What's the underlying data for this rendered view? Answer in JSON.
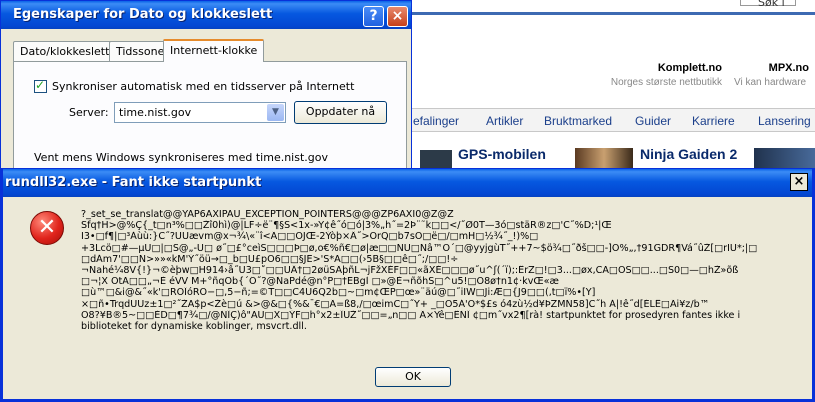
{
  "web": {
    "search_button": "Søk i",
    "partners": [
      {
        "name": "Komplett.no",
        "desc": "Norges største nettbutikk"
      },
      {
        "name": "MPX.no",
        "desc": "Vi kan hardware"
      }
    ],
    "nav": [
      "efalinger",
      "Artikler",
      "Bruktmarked",
      "Guider",
      "Karriere",
      "Lansering"
    ],
    "news": [
      "GPS-mobilen",
      "Ninja Gaiden 2"
    ]
  },
  "props_dialog": {
    "title": "Egenskaper for Dato og klokkeslett",
    "help_button": "?",
    "close_button": "×",
    "tabs": [
      "Dato/klokkeslett",
      "Tidssone",
      "Internett-klokke"
    ],
    "active_tab": 2,
    "sync_label": "Synkroniser automatisk med en tidsserver på Internett",
    "sync_checked": true,
    "server_label": "Server:",
    "server_value": "time.nist.gov",
    "update_button": "Oppdater nå",
    "status_text": "Vent mens Windows synkroniseres med time.nist.gov"
  },
  "error_dialog": {
    "title": "rundll32.exe - Fant ikke startpunkt",
    "close_button": "×",
    "icon": "error-icon",
    "message_lines": [
      "?_set_se_translat@@YAP6AXIPAU_EXCEPTION_POINTERS@@@ZP6AXI0@Z@Z",
      "Sfq†H>@%Ç{_t□n³%□□Žî0hì)@|LF÷ë¨¶§Š<1x-»Y¢ê˝ó□ó|3%„h˝=2Þ¨˜k□□</˝Ø0T—3ó□stäR®z□'C˝%D;¹|Œ",
      "I3•□f¶|□³Àùù:}C˝?ÜÜævm@x¬¾\\«¨î<Ã□□OJŒ-2Ýòþ×Â˝>OrQ□b7sÖ□ë□/□mH□½¾˝_!)%□",
      "+3Lcö□#—µÙ□|□S@„-U□ ø˝□£°ceìS□□□Þ□ø,o€%ñ€□ø|æ□□NÜ□Nâ™O´□@yyjgùT˝++7~$ö¾□˝ðš□□-]Ö%„,†91GDR¶Vá˝ûŽ[□rIÚ*;|□",
      "□dÁm7'□□N>»»«kM'Ý˝öü→□_b□Ü£pÖ6□□§JE>'S*Ä□□(›5B§□□ê□˝;/□□!÷",
      "¬Nahé¼8V{!}¬©èþw□H914›â˝U3□˚□□UÂ†□2øüŠÃþñL¬jFžXÉF□□«ãXÉ□□□ø˝u^ʃ(´ï);:ÊrZ□!□3...□øx,CÄ□ÒŠ□□...□Š0□—□hŽ»õß",
      "□¬¦X OtA□□„¬È éVV M+°ñqÒb{´Õ˝?@ÑaPdé@n°P□†EBgÌ □»@È¬ñõhŠ□^u5!□Ô8ø†n1¢·kvŒ«æ",
      "□ù™□&i@&˝«k'□RÖÎóRÓ−□,5−ñ;=©T□□C4U6Q2b□~□m¢ŒP□œ»¨äú@□˝iÏW□Ji:Æ□{J9□□(,t□ï%•[Ÿ]",
      "×□ñ•TrqdÜÜz±1□²˝ŽA$p<Žè□ú &>@&□{%&¯€□Ã=ß8,/□œimC□˝Ÿ+ _□Ò5Á'O*$£s ó4zù½d¥ÞZMÑ58]C˝h Á|!ê˝d[ÉLÊ□Ãi¥z/b™",
      "Ó8?¥B®5~□□ÈD□¶7¾□/@ÑÎÇ)ô\"AÛ□X□ÝF□h°x2±ÎÜŽ˝□□=„n□□ Ã×Ÿê□ÊÑÎ ¢□m˝vx2¶[rà! startpunktet for prosedyren fantes ikke i",
      "biblioteket for dynamiske koblinger, msvcrt.dll."
    ],
    "ok_button": "OK"
  },
  "colors": {
    "titlebar": "#0454e0",
    "dialog_bg": "#ece9d8",
    "link": "#1b3f8b",
    "error_red": "#e0241c"
  }
}
